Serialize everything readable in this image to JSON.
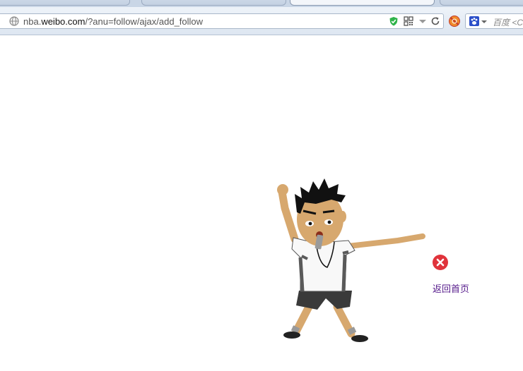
{
  "browser": {
    "tabs": [
      {
        "label": "…",
        "active": false
      },
      {
        "label": "…",
        "active": false
      },
      {
        "label": "…",
        "active": true
      },
      {
        "label": "…",
        "active": false
      }
    ],
    "url": {
      "prefix": "nba.",
      "host": "weibo.com",
      "path": "/?anu=follow/ajax/add_follow"
    },
    "search_placeholder": "百度 <C"
  },
  "page": {
    "back_home_label": "返回首页"
  },
  "colors": {
    "error_red": "#e0333b",
    "link": "#551a8b",
    "shield_green": "#2fb34a"
  },
  "icons": [
    "globe-icon",
    "shield-icon",
    "qr-code-icon",
    "dropdown-icon",
    "reload-icon",
    "extension-icon",
    "baidu-paw-icon",
    "error-x-icon"
  ]
}
